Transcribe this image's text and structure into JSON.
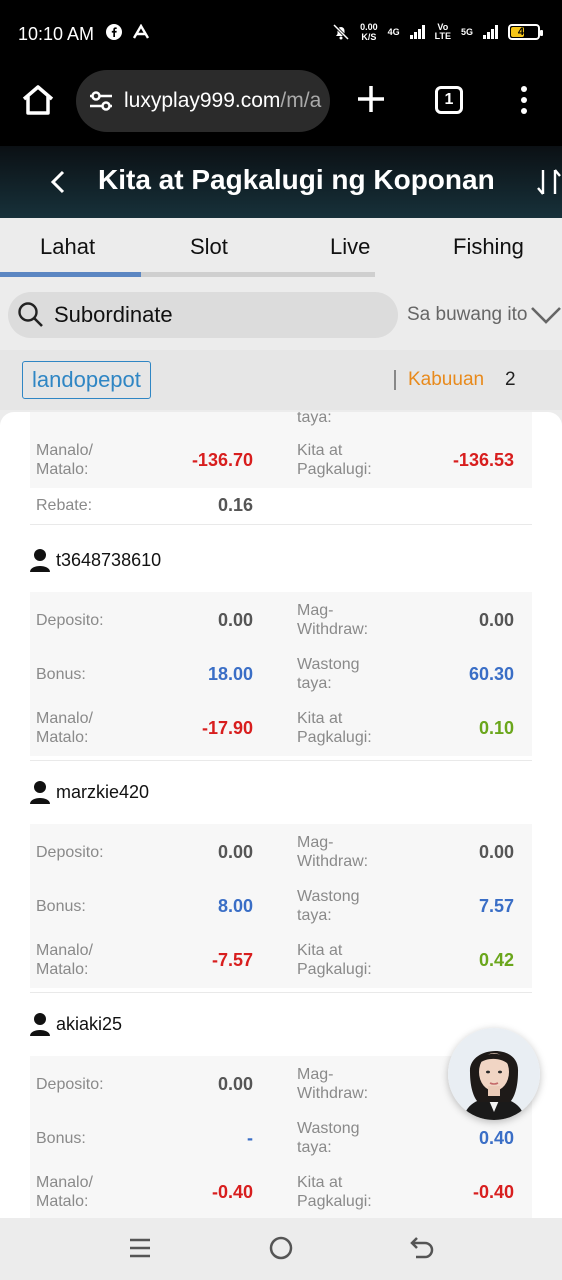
{
  "status": {
    "time": "10:10 AM",
    "netspeed_value": "0.00",
    "netspeed_unit": "K/S",
    "tech_4g": "4G",
    "tech_volte_1": "Vo",
    "tech_volte_2": "LTE",
    "tech_5g": "5G",
    "battery": "46",
    "battery_level": 0.46
  },
  "browser": {
    "url": "luxyplay999.com",
    "url_suffix": "/m/a",
    "tab_count": "1"
  },
  "header": {
    "title": "Kita at Pagkalugi ng Koponan"
  },
  "tabs": [
    {
      "label": "Lahat",
      "active": true
    },
    {
      "label": "Slot"
    },
    {
      "label": "Live"
    },
    {
      "label": "Fishing"
    }
  ],
  "search": {
    "text": "Subordinate",
    "period": "Sa buwang ito"
  },
  "filter": {
    "chip": "landopepot",
    "total_label": "Kabuuan",
    "total_count": "2"
  },
  "first_card": {
    "partial_label": "taya:",
    "manalo_label": "Manalo/\nMatalo:",
    "manalo_value": "-136.70",
    "kita_label": "Kita at\nPagkalugi:",
    "kita_value": "-136.53",
    "rebate_label": "Rebate:",
    "rebate_value": "0.16"
  },
  "members": [
    {
      "name": "t3648738610",
      "deposito_label": "Deposito:",
      "deposito": "0.00",
      "withdraw_label": "Mag-\nWithdraw:",
      "withdraw": "0.00",
      "bonus_label": "Bonus:",
      "bonus": "18.00",
      "wastong_label": "Wastong\ntaya:",
      "wastong": "60.30",
      "manalo_label": "Manalo/\nMatalo:",
      "manalo": "-17.90",
      "kita_label": "Kita at\nPagkalugi:",
      "kita": "0.10"
    },
    {
      "name": "marzkie420",
      "deposito_label": "Deposito:",
      "deposito": "0.00",
      "withdraw_label": "Mag-\nWithdraw:",
      "withdraw": "0.00",
      "bonus_label": "Bonus:",
      "bonus": "8.00",
      "wastong_label": "Wastong\ntaya:",
      "wastong": "7.57",
      "manalo_label": "Manalo/\nMatalo:",
      "manalo": "-7.57",
      "kita_label": "Kita at\nPagkalugi:",
      "kita": "0.42"
    },
    {
      "name": "akiaki25",
      "deposito_label": "Deposito:",
      "deposito": "0.00",
      "withdraw_label": "Mag-\nWithdraw:",
      "withdraw": "",
      "bonus_label": "Bonus:",
      "bonus": "-",
      "wastong_label": "Wastong\ntaya:",
      "wastong": "0.40",
      "manalo_label": "Manalo/\nMatalo:",
      "manalo": "-0.40",
      "kita_label": "Kita at\nPagkalugi:",
      "kita": "-0.40"
    }
  ],
  "colors": {
    "negative": "#d81e1e",
    "positive": "#6aa61b",
    "info": "#3a6ec6",
    "accent": "#e88a1c"
  }
}
